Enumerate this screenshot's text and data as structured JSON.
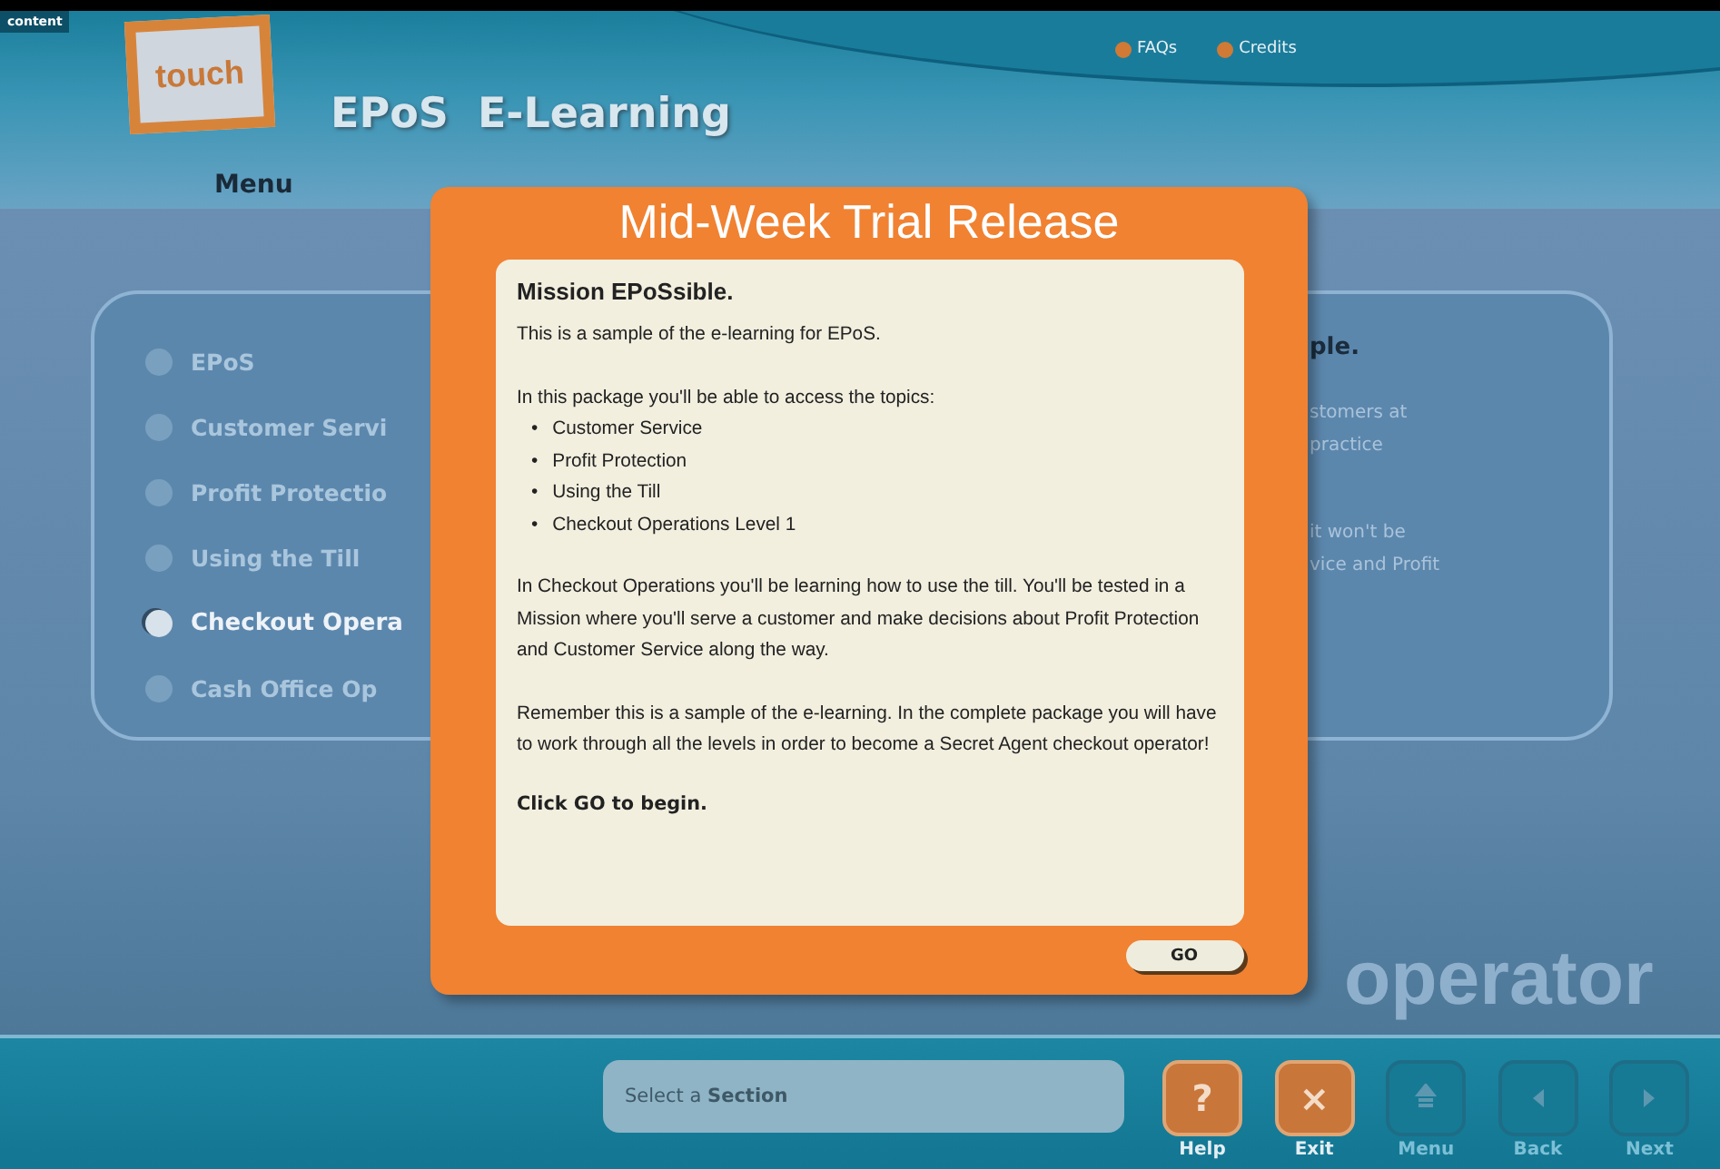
{
  "corner_label": "content",
  "logo": {
    "text": "touch"
  },
  "app_title": "EPoS  E-Learning",
  "top_links": [
    {
      "label": "FAQs"
    },
    {
      "label": "Credits"
    }
  ],
  "menu": {
    "title": "Menu",
    "items": [
      {
        "label": "EPoS",
        "selected": false,
        "disabled": true
      },
      {
        "label": "Customer Servi",
        "selected": false,
        "disabled": true
      },
      {
        "label": "Profit Protectio",
        "selected": false,
        "disabled": true
      },
      {
        "label": "Using the Till",
        "selected": false,
        "disabled": true
      },
      {
        "label": "Checkout Opera",
        "selected": true,
        "disabled": false
      },
      {
        "label": "Cash Office Op",
        "selected": false,
        "disabled": true
      }
    ],
    "description_fragments": [
      {
        "text": "ple.",
        "kind": "heading"
      },
      {
        "text": "stomers at",
        "kind": "line"
      },
      {
        "text": "practice",
        "kind": "line"
      },
      {
        "text": "it won't be",
        "kind": "gap"
      },
      {
        "text": "vice and Profit",
        "kind": "line"
      }
    ],
    "background_word": "operator"
  },
  "dialog": {
    "title": "Mid-Week Trial Release",
    "heading": "Mission EPoSsible.",
    "intro": "This is a sample of the e-learning for EPoS.",
    "topics_intro": "In this package you'll be able to access the topics:",
    "topics": [
      {
        "bullet": "•",
        "text": "Customer Service"
      },
      {
        "bullet": "•",
        "text": "Profit Protection"
      },
      {
        "bullet": "•",
        "text": "Using the Till"
      },
      {
        "bullet": "•",
        "text": "Checkout Operations Level 1"
      }
    ],
    "paragraphs": [
      "In Checkout Operations you'll be learning how to use the till. You'll be tested in a Mission where you'll serve a customer and make decisions about Profit Protection and Customer Service along the way.",
      "Remember this is a sample of the e-learning.  In the complete package you will have to work through all the levels in order to become a Secret Agent checkout operator!"
    ],
    "call_to_action": "Click GO to begin.",
    "button": "GO"
  },
  "nav_bar": {
    "status_field": "Select a **Section**",
    "buttons": [
      {
        "kind": "help",
        "symbol": "?",
        "label": "Help",
        "disabled": false
      },
      {
        "kind": "exit",
        "symbol": "×",
        "label": "Exit",
        "disabled": false
      },
      {
        "kind": "menu",
        "label": "Menu",
        "disabled": true
      },
      {
        "kind": "back",
        "label": "Back",
        "disabled": true
      },
      {
        "kind": "next",
        "label": "Next",
        "disabled": true
      }
    ]
  }
}
